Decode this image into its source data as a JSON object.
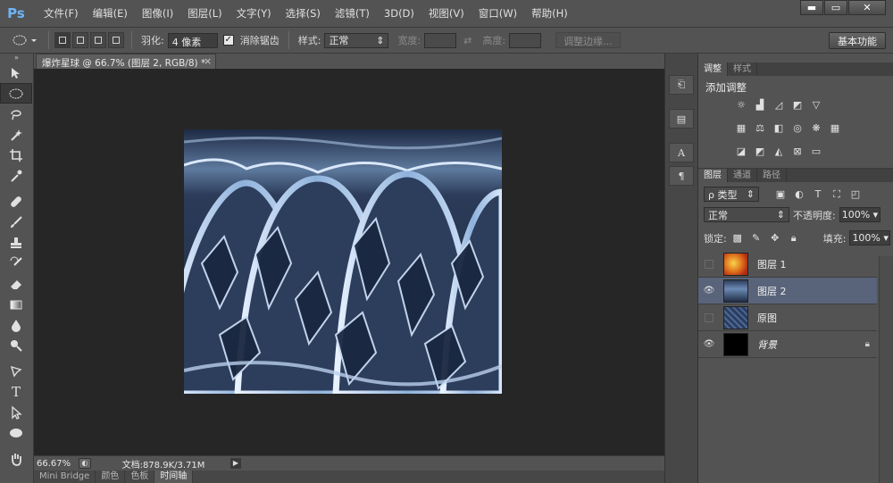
{
  "app": {
    "logo": "Ps"
  },
  "menu": [
    "文件(F)",
    "编辑(E)",
    "图像(I)",
    "图层(L)",
    "文字(Y)",
    "选择(S)",
    "滤镜(T)",
    "3D(D)",
    "视图(V)",
    "窗口(W)",
    "帮助(H)"
  ],
  "window_controls": {
    "minimize": "▬",
    "maximize": "▭",
    "close": "✕"
  },
  "options": {
    "feather_label": "羽化:",
    "feather_value": "4 像素",
    "antialias_label": "消除锯齿",
    "antialias_checked": true,
    "style_label": "样式:",
    "style_value": "正常",
    "width_label": "宽度:",
    "height_label": "高度:",
    "refine_edge_label": "调整边缘...",
    "workspace_label": "基本功能"
  },
  "document": {
    "tab_title": "爆炸星球 @ 66.7% (图层 2, RGB/8) *",
    "tab_close": "×",
    "zoom": "66.67%",
    "doc_size": "文档:878.9K/3.71M"
  },
  "bottom_tabs": [
    "Mini Bridge",
    "颜色",
    "色板",
    "时间轴"
  ],
  "bottom_tabs_active": 3,
  "adjustments": {
    "tabs": [
      "调整",
      "样式"
    ],
    "title": "添加调整"
  },
  "layers": {
    "tabs": [
      "图层",
      "通道",
      "路径"
    ],
    "filter_label": "ρ 类型",
    "blend_mode": "正常",
    "opacity_label": "不透明度:",
    "opacity_value": "100%",
    "lock_label": "锁定:",
    "fill_label": "填充:",
    "fill_value": "100%",
    "items": [
      {
        "name": "图层 1",
        "visible": false,
        "selected": false
      },
      {
        "name": "图层 2",
        "visible": true,
        "selected": true
      },
      {
        "name": "原图",
        "visible": false,
        "selected": false
      },
      {
        "name": "背景",
        "visible": true,
        "selected": false,
        "locked": true
      }
    ]
  },
  "colors": {
    "accent": "#6eb3f7",
    "selected_layer": "#59647b",
    "canvas_bg": "#262626",
    "ui_bg": "#535353"
  }
}
